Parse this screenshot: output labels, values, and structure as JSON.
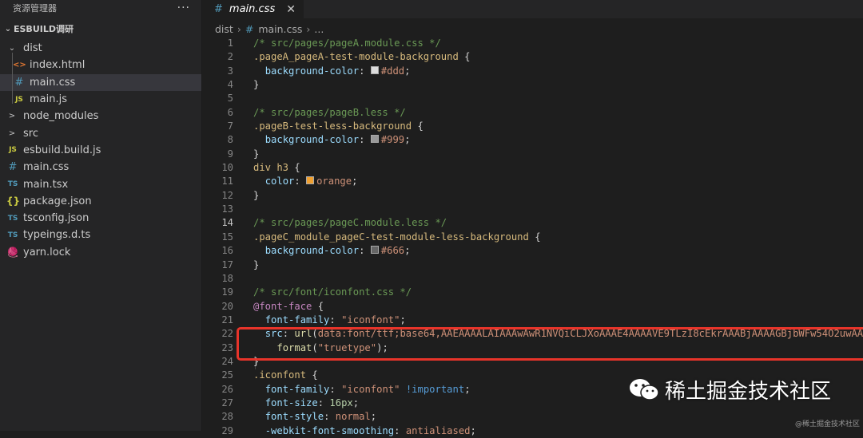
{
  "sidebar": {
    "title": "资源管理器",
    "more": "···",
    "project": "ESBUILD调研",
    "items": [
      {
        "label": "dist",
        "icon": "chevron-down-icon",
        "glyph": "⌄",
        "depth": 0,
        "folder": true
      },
      {
        "label": "index.html",
        "icon": "html-file-icon",
        "glyph": "<>",
        "depth": 1
      },
      {
        "label": "main.css",
        "icon": "css-file-icon",
        "glyph": "#",
        "depth": 1,
        "selected": true
      },
      {
        "label": "main.js",
        "icon": "js-file-icon",
        "glyph": "JS",
        "depth": 1
      },
      {
        "label": "node_modules",
        "icon": "chevron-right-icon",
        "glyph": ">",
        "depth": 0,
        "folder": true
      },
      {
        "label": "src",
        "icon": "chevron-right-icon",
        "glyph": ">",
        "depth": 0,
        "folder": true
      },
      {
        "label": "esbuild.build.js",
        "icon": "js-file-icon",
        "glyph": "JS",
        "depth": 0
      },
      {
        "label": "main.css",
        "icon": "css-file-icon",
        "glyph": "#",
        "depth": 0
      },
      {
        "label": "main.tsx",
        "icon": "ts-file-icon",
        "glyph": "TS",
        "depth": 0
      },
      {
        "label": "package.json",
        "icon": "json-file-icon",
        "glyph": "{}",
        "depth": 0
      },
      {
        "label": "tsconfig.json",
        "icon": "tsconfig-file-icon",
        "glyph": "TS",
        "depth": 0
      },
      {
        "label": "typeings.d.ts",
        "icon": "ts-file-icon",
        "glyph": "TS",
        "depth": 0
      },
      {
        "label": "yarn.lock",
        "icon": "yarn-file-icon",
        "glyph": "🧶",
        "depth": 0
      }
    ]
  },
  "tab": {
    "label": "main.css",
    "close": "✕"
  },
  "breadcrumb": {
    "folder": "dist",
    "file": "main.css",
    "more": "..."
  },
  "editor": {
    "active_line": 14,
    "lines": [
      [
        [
          "/* src/pages/pageA.module.css */",
          "c-comment"
        ]
      ],
      [
        [
          ".pageA_pageA-test-module-background",
          "c-sel"
        ],
        [
          " {",
          ""
        ]
      ],
      [
        [
          "  ",
          ""
        ],
        [
          "background-color",
          "c-prop"
        ],
        [
          ": ",
          ""
        ],
        [
          "#ddd",
          "swatch"
        ],
        [
          ";",
          ""
        ]
      ],
      [
        [
          "}",
          ""
        ]
      ],
      [
        [
          "",
          ""
        ]
      ],
      [
        [
          "/* src/pages/pageB.less */",
          "c-comment"
        ]
      ],
      [
        [
          ".pageB-test-less-background",
          "c-sel"
        ],
        [
          " {",
          ""
        ]
      ],
      [
        [
          "  ",
          ""
        ],
        [
          "background-color",
          "c-prop"
        ],
        [
          ": ",
          ""
        ],
        [
          "#999",
          "swatch"
        ],
        [
          ";",
          ""
        ]
      ],
      [
        [
          "}",
          ""
        ]
      ],
      [
        [
          "div h3",
          "c-sel"
        ],
        [
          " {",
          ""
        ]
      ],
      [
        [
          "  ",
          ""
        ],
        [
          "color",
          "c-prop"
        ],
        [
          ": ",
          ""
        ],
        [
          "orange",
          "swatch"
        ],
        [
          ";",
          ""
        ]
      ],
      [
        [
          "}",
          ""
        ]
      ],
      [
        [
          "",
          ""
        ]
      ],
      [
        [
          "/* src/pages/pageC.module.less */",
          "c-comment"
        ]
      ],
      [
        [
          ".pageC_module_pageC-test-module-less-background",
          "c-sel"
        ],
        [
          " {",
          ""
        ]
      ],
      [
        [
          "  ",
          ""
        ],
        [
          "background-color",
          "c-prop"
        ],
        [
          ": ",
          ""
        ],
        [
          "#666",
          "swatch"
        ],
        [
          ";",
          ""
        ]
      ],
      [
        [
          "}",
          ""
        ]
      ],
      [
        [
          "",
          ""
        ]
      ],
      [
        [
          "/* src/font/iconfont.css */",
          "c-comment"
        ]
      ],
      [
        [
          "@font-face",
          "c-kw"
        ],
        [
          " {",
          ""
        ]
      ],
      [
        [
          "  ",
          ""
        ],
        [
          "font-family",
          "c-prop"
        ],
        [
          ": ",
          ""
        ],
        [
          "\"iconfont\"",
          "c-val"
        ],
        [
          ";",
          ""
        ]
      ],
      [
        [
          "  ",
          ""
        ],
        [
          "src",
          "c-prop"
        ],
        [
          ": ",
          ""
        ],
        [
          "url",
          "c-fn"
        ],
        [
          "(",
          ""
        ],
        [
          "data:font/ttf;base64,AAEAAAALAIAAAwAwR1NVQiCLJXoAAAE4AAAAVE9TLzI8cEkrAAABjAAAAGBjbWFw54O2uwAAAfQAA",
          "c-val"
        ]
      ],
      [
        [
          "    ",
          ""
        ],
        [
          "format",
          "c-fn"
        ],
        [
          "(",
          ""
        ],
        [
          "\"truetype\"",
          "c-val"
        ],
        [
          ");",
          ""
        ]
      ],
      [
        [
          "}",
          ""
        ]
      ],
      [
        [
          ".iconfont",
          "c-sel"
        ],
        [
          " {",
          ""
        ]
      ],
      [
        [
          "  ",
          ""
        ],
        [
          "font-family",
          "c-prop"
        ],
        [
          ": ",
          ""
        ],
        [
          "\"iconfont\"",
          "c-val"
        ],
        [
          " ",
          ""
        ],
        [
          "!important",
          "c-imp"
        ],
        [
          ";",
          ""
        ]
      ],
      [
        [
          "  ",
          ""
        ],
        [
          "font-size",
          "c-prop"
        ],
        [
          ": ",
          ""
        ],
        [
          "16px",
          "c-num"
        ],
        [
          ";",
          ""
        ]
      ],
      [
        [
          "  ",
          ""
        ],
        [
          "font-style",
          "c-prop"
        ],
        [
          ": ",
          ""
        ],
        [
          "normal",
          "c-val"
        ],
        [
          ";",
          ""
        ]
      ],
      [
        [
          "  ",
          ""
        ],
        [
          "-webkit-font-smoothing",
          "c-prop"
        ],
        [
          ": ",
          ""
        ],
        [
          "antialiased",
          "c-val"
        ],
        [
          ";",
          ""
        ]
      ]
    ]
  },
  "swatches": {
    "#ddd": "#dddddd",
    "#999": "#999999",
    "orange": "#f0a030",
    "#666": "#666666"
  },
  "watermark": {
    "text": "稀土掘金技术社区",
    "small": "@稀土掘金技术社区"
  }
}
